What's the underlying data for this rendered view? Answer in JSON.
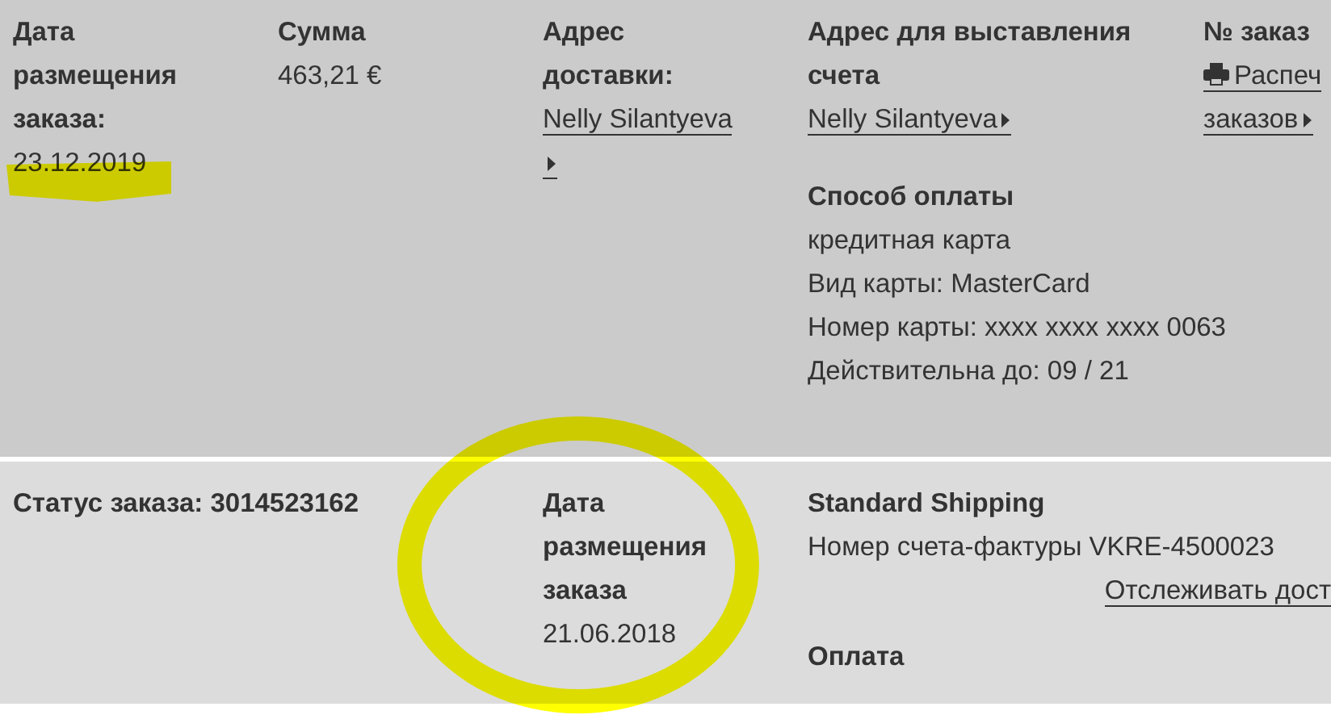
{
  "order_summary": {
    "placed": {
      "label": "Дата размещения заказа:",
      "value": "23.12.2019"
    },
    "total": {
      "label": "Сумма",
      "value": "463,21 €"
    },
    "shipping_address": {
      "label": "Адрес доставки:",
      "link": "Nelly Silantyeva"
    },
    "billing_address": {
      "label": "Адрес для выставления счета",
      "link": "Nelly Silantyeva"
    },
    "order_number": {
      "label": "№ заказ",
      "link": [
        "Распеч",
        "заказов"
      ]
    },
    "payment": {
      "title": "Способ оплаты",
      "lines": [
        "кредитная карта",
        "Вид карты: MasterCard",
        "Номер карты: xxxx xxxx xxxx 0063",
        "Действительна до: 09 / 21"
      ]
    }
  },
  "order_row": {
    "status": "Статус заказа: 3014523162",
    "placed_label": "Дата размещения заказа",
    "placed_value": "21.06.2018",
    "shipping": "Standard Shipping",
    "invoice": "Номер счета-фактуры VKRE-4500023",
    "track_link": "Отслеживать дост",
    "payment_title": "Оплата"
  },
  "annotations": [
    {
      "kind": "underline"
    },
    {
      "kind": "circle"
    }
  ]
}
